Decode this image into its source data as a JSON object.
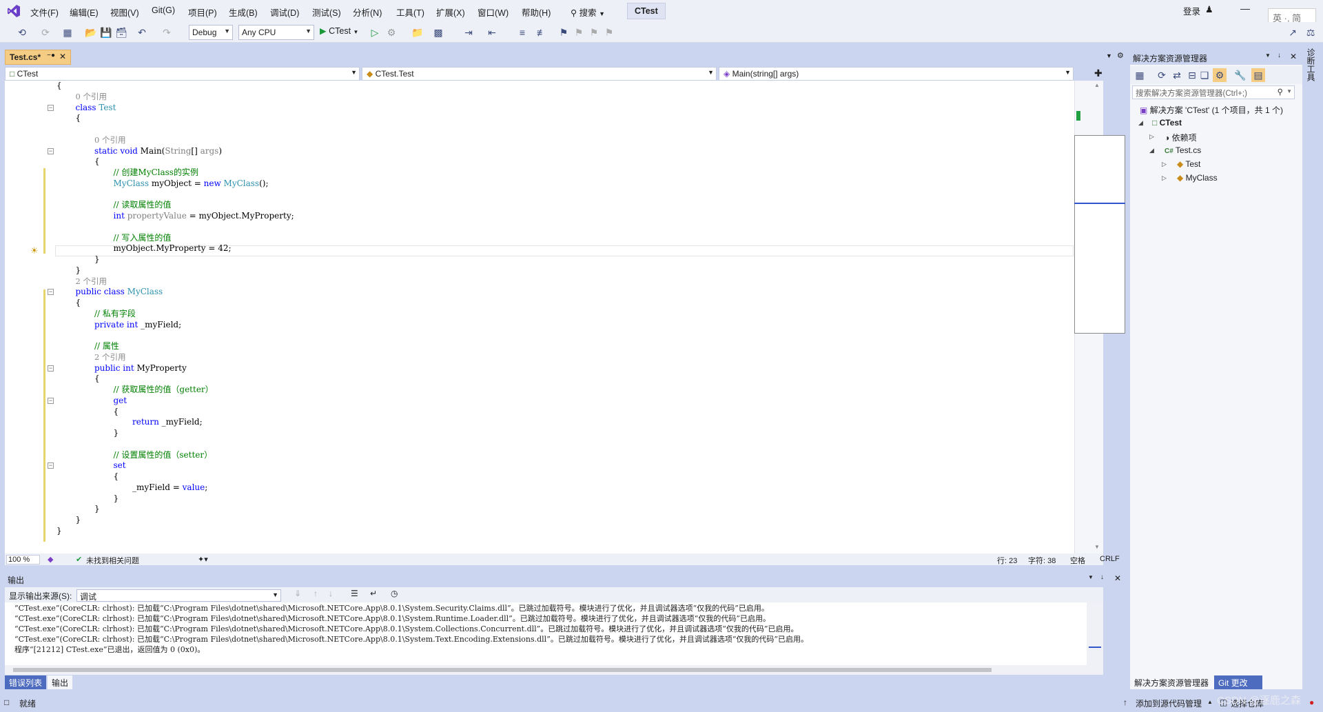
{
  "menubar": {
    "items": [
      "文件(F)",
      "编辑(E)",
      "视图(V)",
      "Git(G)",
      "项目(P)",
      "生成(B)",
      "调试(D)",
      "测试(S)",
      "分析(N)",
      "工具(T)",
      "扩展(X)",
      "窗口(W)",
      "帮助(H)"
    ],
    "search_label": "搜索",
    "project_name": "CTest",
    "login": "登录",
    "ime": "英 ·, 简"
  },
  "toolbar": {
    "config": "Debug",
    "platform": "Any CPU",
    "run_target": "CTest"
  },
  "editor": {
    "tab_title": "Test.cs*",
    "nav_project": "CTest",
    "nav_class": "CTest.Test",
    "nav_member": "Main(string[] args)",
    "zoom": "100 %",
    "issues": "未找到相关问题",
    "line": "行: 23",
    "char": "字符: 38",
    "spacing": "空格",
    "eol": "CRLF",
    "code": [
      {
        "i": 0,
        "parts": [
          {
            "t": "{",
            "c": "plain"
          }
        ]
      },
      {
        "i": 1,
        "parts": [
          {
            "t": "0 个引用",
            "c": "lens"
          }
        ]
      },
      {
        "i": 1,
        "parts": [
          {
            "t": "class ",
            "c": "kw"
          },
          {
            "t": "Test",
            "c": "type"
          }
        ]
      },
      {
        "i": 1,
        "parts": [
          {
            "t": "{",
            "c": "plain"
          }
        ]
      },
      {
        "i": 1,
        "parts": [
          {
            "t": "",
            "c": "plain"
          }
        ]
      },
      {
        "i": 2,
        "parts": [
          {
            "t": "0 个引用",
            "c": "lens"
          }
        ]
      },
      {
        "i": 2,
        "parts": [
          {
            "t": "static void ",
            "c": "kw"
          },
          {
            "t": "Main(",
            "c": "plain"
          },
          {
            "t": "String",
            "c": "param"
          },
          {
            "t": "[] ",
            "c": "plain"
          },
          {
            "t": "args",
            "c": "param"
          },
          {
            "t": ")",
            "c": "plain"
          }
        ]
      },
      {
        "i": 2,
        "parts": [
          {
            "t": "{",
            "c": "plain"
          }
        ]
      },
      {
        "i": 3,
        "parts": [
          {
            "t": "// 创建MyClass的实例",
            "c": "cmt"
          }
        ]
      },
      {
        "i": 3,
        "parts": [
          {
            "t": "MyClass",
            "c": "type"
          },
          {
            "t": " myObject = ",
            "c": "plain"
          },
          {
            "t": "new ",
            "c": "kw"
          },
          {
            "t": "MyClass",
            "c": "type"
          },
          {
            "t": "();",
            "c": "plain"
          }
        ]
      },
      {
        "i": 3,
        "parts": [
          {
            "t": "",
            "c": "plain"
          }
        ]
      },
      {
        "i": 3,
        "parts": [
          {
            "t": "// 读取属性的值",
            "c": "cmt"
          }
        ]
      },
      {
        "i": 3,
        "parts": [
          {
            "t": "int ",
            "c": "kw"
          },
          {
            "t": "propertyValue",
            "c": "param"
          },
          {
            "t": " = myObject.MyProperty;",
            "c": "plain"
          }
        ]
      },
      {
        "i": 3,
        "parts": [
          {
            "t": "",
            "c": "plain"
          }
        ]
      },
      {
        "i": 3,
        "parts": [
          {
            "t": "// 写入属性的值",
            "c": "cmt"
          }
        ]
      },
      {
        "i": 3,
        "parts": [
          {
            "t": "myObject.MyProperty = 42;",
            "c": "plain"
          }
        ]
      },
      {
        "i": 2,
        "parts": [
          {
            "t": "}",
            "c": "plain"
          }
        ]
      },
      {
        "i": 1,
        "parts": [
          {
            "t": "}",
            "c": "plain"
          }
        ]
      },
      {
        "i": 1,
        "parts": [
          {
            "t": "2 个引用",
            "c": "lens"
          }
        ]
      },
      {
        "i": 1,
        "parts": [
          {
            "t": "public class ",
            "c": "kw"
          },
          {
            "t": "MyClass",
            "c": "type"
          }
        ]
      },
      {
        "i": 1,
        "parts": [
          {
            "t": "{",
            "c": "plain"
          }
        ]
      },
      {
        "i": 2,
        "parts": [
          {
            "t": "// 私有字段",
            "c": "cmt"
          }
        ]
      },
      {
        "i": 2,
        "parts": [
          {
            "t": "private int ",
            "c": "kw"
          },
          {
            "t": "_myField;",
            "c": "plain"
          }
        ]
      },
      {
        "i": 2,
        "parts": [
          {
            "t": "",
            "c": "plain"
          }
        ]
      },
      {
        "i": 2,
        "parts": [
          {
            "t": "// 属性",
            "c": "cmt"
          }
        ]
      },
      {
        "i": 2,
        "parts": [
          {
            "t": "2 个引用",
            "c": "lens"
          }
        ]
      },
      {
        "i": 2,
        "parts": [
          {
            "t": "public int ",
            "c": "kw"
          },
          {
            "t": "MyProperty",
            "c": "plain"
          }
        ]
      },
      {
        "i": 2,
        "parts": [
          {
            "t": "{",
            "c": "plain"
          }
        ]
      },
      {
        "i": 3,
        "parts": [
          {
            "t": "// 获取属性的值（getter）",
            "c": "cmt"
          }
        ]
      },
      {
        "i": 3,
        "parts": [
          {
            "t": "get",
            "c": "kw"
          }
        ]
      },
      {
        "i": 3,
        "parts": [
          {
            "t": "{",
            "c": "plain"
          }
        ]
      },
      {
        "i": 4,
        "parts": [
          {
            "t": "return ",
            "c": "kw"
          },
          {
            "t": "_myField;",
            "c": "plain"
          }
        ]
      },
      {
        "i": 3,
        "parts": [
          {
            "t": "}",
            "c": "plain"
          }
        ]
      },
      {
        "i": 3,
        "parts": [
          {
            "t": "",
            "c": "plain"
          }
        ]
      },
      {
        "i": 3,
        "parts": [
          {
            "t": "// 设置属性的值（setter）",
            "c": "cmt"
          }
        ]
      },
      {
        "i": 3,
        "parts": [
          {
            "t": "set",
            "c": "kw"
          }
        ]
      },
      {
        "i": 3,
        "parts": [
          {
            "t": "{",
            "c": "plain"
          }
        ]
      },
      {
        "i": 4,
        "parts": [
          {
            "t": "_myField = ",
            "c": "plain"
          },
          {
            "t": "value",
            "c": "kw"
          },
          {
            "t": ";",
            "c": "plain"
          }
        ]
      },
      {
        "i": 3,
        "parts": [
          {
            "t": "}",
            "c": "plain"
          }
        ]
      },
      {
        "i": 2,
        "parts": [
          {
            "t": "}",
            "c": "plain"
          }
        ]
      },
      {
        "i": 1,
        "parts": [
          {
            "t": "}",
            "c": "plain"
          }
        ]
      },
      {
        "i": 0,
        "parts": [
          {
            "t": "}",
            "c": "plain"
          }
        ]
      }
    ]
  },
  "output": {
    "title": "输出",
    "source_label": "显示输出来源(S):",
    "source_value": "调试",
    "lines": [
      "“CTest.exe”(CoreCLR: clrhost): 已加载“C:\\Program Files\\dotnet\\shared\\Microsoft.NETCore.App\\8.0.1\\System.Security.Claims.dll”。已跳过加载符号。模块进行了优化，并且调试器选项“仅我的代码”已启用。",
      "“CTest.exe”(CoreCLR: clrhost): 已加载“C:\\Program Files\\dotnet\\shared\\Microsoft.NETCore.App\\8.0.1\\System.Runtime.Loader.dll”。已跳过加载符号。模块进行了优化，并且调试器选项“仅我的代码”已启用。",
      "“CTest.exe”(CoreCLR: clrhost): 已加载“C:\\Program Files\\dotnet\\shared\\Microsoft.NETCore.App\\8.0.1\\System.Collections.Concurrent.dll”。已跳过加载符号。模块进行了优化，并且调试器选项“仅我的代码”已启用。",
      "“CTest.exe”(CoreCLR: clrhost): 已加载“C:\\Program Files\\dotnet\\shared\\Microsoft.NETCore.App\\8.0.1\\System.Text.Encoding.Extensions.dll”。已跳过加载符号。模块进行了优化，并且调试器选项“仅我的代码”已启用。",
      "程序“[21212] CTest.exe”已退出，返回值为 0 (0x0)。"
    ],
    "tab_errors": "错误列表",
    "tab_output": "输出"
  },
  "solution_explorer": {
    "title": "解决方案资源管理器",
    "search_placeholder": "搜索解决方案资源管理器(Ctrl+;)",
    "solution": "解决方案 'CTest' (1 个项目，共 1 个)",
    "project": "CTest",
    "dependencies": "依赖项",
    "file": "Test.cs",
    "class_test": "Test",
    "class_myclass": "MyClass",
    "tab_se": "解决方案资源管理器",
    "tab_git": "Git 更改",
    "side_strip": "诊断工具"
  },
  "statusbar": {
    "ready": "就绪",
    "add_source": "添加到源代码管理",
    "select_repo": "选择仓库",
    "watermark": "CSDN @逐鹿之森"
  }
}
